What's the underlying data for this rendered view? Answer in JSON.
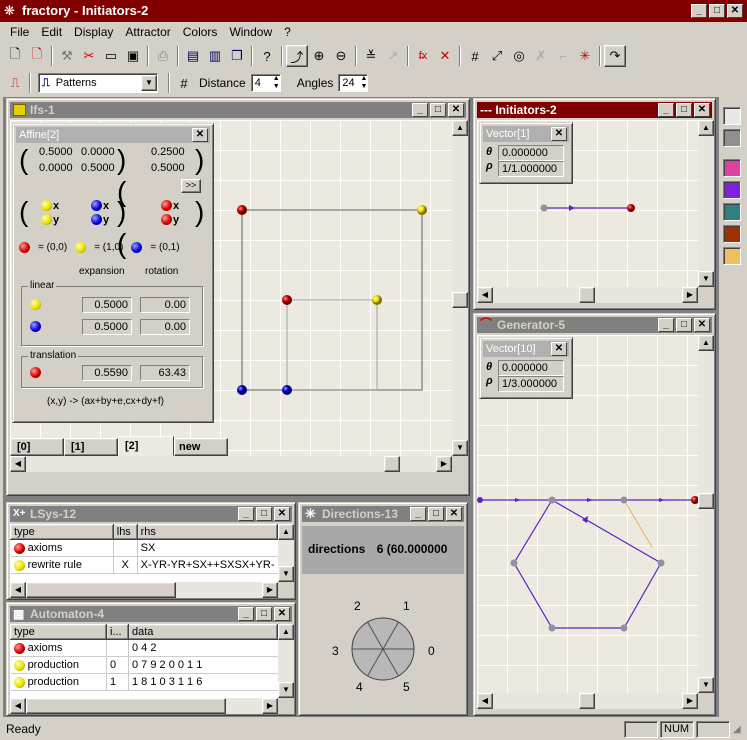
{
  "app": {
    "title": "fractory - Initiators-2"
  },
  "menu": [
    "File",
    "Edit",
    "Display",
    "Attractor",
    "Colors",
    "Window",
    "?"
  ],
  "toolbar2": {
    "pattern": "Patterns",
    "distance_label": "Distance",
    "distance": "4",
    "angles_label": "Angles",
    "angles": "24"
  },
  "ifs": {
    "title": "Ifs-1",
    "tabs": [
      "[0]",
      "[1]",
      "[2]",
      "new"
    ]
  },
  "affine": {
    "title": "Affine[2]",
    "m": [
      "0.5000",
      "0.0000",
      "0.0000",
      "0.5000"
    ],
    "v": [
      "0.2500",
      "0.5000"
    ],
    "more": ">>",
    "legend": [
      "= (0,0)",
      "= (1,0)",
      "= (0,1)"
    ],
    "col_expansion": "expansion",
    "col_rotation": "rotation",
    "linear_label": "linear",
    "lin1": [
      "0.5000",
      "0.00"
    ],
    "lin2": [
      "0.5000",
      "0.00"
    ],
    "translation_label": "translation",
    "trans": [
      "0.5590",
      "63.43"
    ],
    "formula": "(x,y)  ->  (ax+by+e,cx+dy+f)",
    "x": "x",
    "y": "y"
  },
  "initiators": {
    "title": "--- Initiators-2",
    "vec_title": "Vector[1]",
    "theta": "0.000000",
    "rho": "1/1.000000",
    "theta_sym": "θ",
    "rho_sym": "ρ"
  },
  "generator": {
    "title": "Generator-5",
    "vec_title": "Vector[10]",
    "theta": "0.000000",
    "rho": "1/3.000000",
    "theta_sym": "θ",
    "rho_sym": "ρ"
  },
  "lsys": {
    "title": "LSys-12",
    "cols": [
      "type",
      "lhs",
      "rhs"
    ],
    "rows": [
      [
        "axioms",
        "",
        "SX"
      ],
      [
        "rewrite rule",
        "X",
        "X-YR-YR+SX++SXSX+YR-"
      ]
    ]
  },
  "directions": {
    "title": "Directions-13",
    "label": "directions",
    "value": "6 (60.000000",
    "nums": [
      "0",
      "1",
      "2",
      "3",
      "4",
      "5"
    ]
  },
  "automaton": {
    "title": "Automaton-4",
    "cols": [
      "type",
      "i...",
      "data"
    ],
    "rows": [
      [
        "axioms",
        "",
        "0 4 2"
      ],
      [
        "production",
        "0",
        "0 7 9 2 0 0 1 1"
      ],
      [
        "production",
        "1",
        "1 8 1 0 3 1 1 6"
      ]
    ]
  },
  "status": {
    "ready": "Ready",
    "num": "NUM"
  },
  "colors": {
    "titlebar": "#800000",
    "palette": [
      "#e8e8e8",
      "#909090",
      "#e040a0",
      "#8020e0",
      "#308080",
      "#a03000",
      "#f0c060"
    ]
  }
}
